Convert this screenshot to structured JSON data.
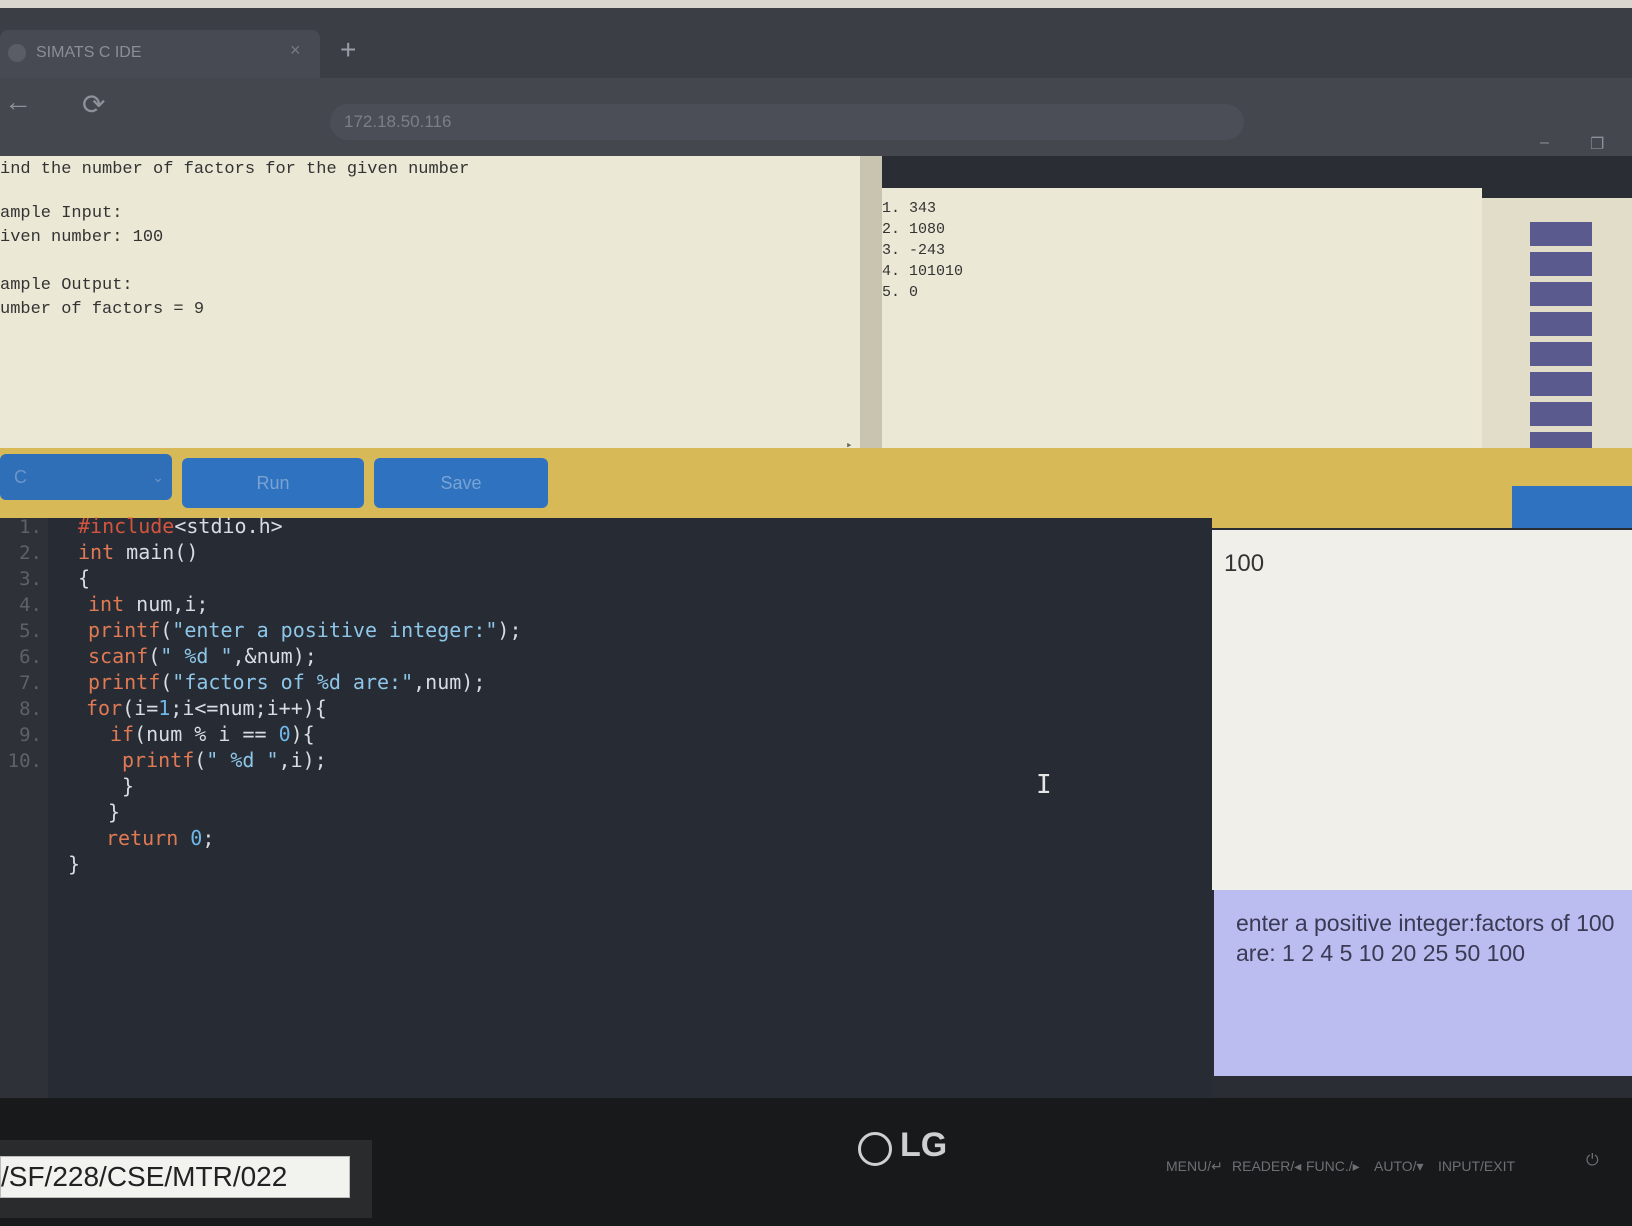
{
  "browser": {
    "tab_title": "SIMATS C IDE",
    "tab_close": "×",
    "new_tab": "+",
    "back": "←",
    "reload": "⟳",
    "url": "172.18.50.116",
    "minimize": "–",
    "restore": "❐"
  },
  "problem": {
    "title": "ind the number of factors for the given number",
    "sample": "ample Input:\niven number: 100\n\nample Output:\number of factors = 9",
    "arrow_down": "▾",
    "arrow_right": "▸",
    "arrow_left": "◂"
  },
  "testcases": [
    "1. 343",
    "2. 1080",
    "3. -243",
    "4. 101010",
    "5. 0"
  ],
  "actions": {
    "language": "C",
    "language_chevron": "⌄",
    "run_label": "Run",
    "save_label": "Save"
  },
  "editor": {
    "line_numbers": [
      "1.",
      "2.",
      "3.",
      "4.",
      "5.",
      "6.",
      "7.",
      "8.",
      "9.",
      "10."
    ],
    "code": {
      "l1_pre": "#include",
      "l1_rest": "<stdio.h>",
      "l2_kw": "int",
      "l2_rest": " main()",
      "l3": "{",
      "l4_kw": "int",
      "l4_rest": " num,i;",
      "l5_fn": "printf",
      "l5_p1": "(",
      "l5_str": "\"enter a positive integer:\"",
      "l5_p2": ");",
      "l6_fn": "scanf",
      "l6_p1": "(",
      "l6_str": "\" %d \"",
      "l6_p2": ",&num);",
      "l7_fn": "printf",
      "l7_p1": "(",
      "l7_str": "\"factors of %d are:\"",
      "l7_p2": ",num);",
      "l8_kw": "for",
      "l8_p1": "(i=",
      "l8_num1": "1",
      "l8_p2": ";i<=num;i++){",
      "l9_kw": "if",
      "l9_p1": "(num % i == ",
      "l9_num": "0",
      "l9_p2": "){",
      "l10_fn": "printf",
      "l10_p1": "(",
      "l10_str": "\" %d \"",
      "l10_p2": ",i);",
      "l11": "}",
      "l12": "}",
      "l13_kw": "return",
      "l13_p1": " ",
      "l13_num": "0",
      "l13_p2": ";",
      "l14": "}"
    },
    "cursor_glyph": "I"
  },
  "io": {
    "input_value": "100",
    "output_text": "enter a positive integer:factors of 100 are: 1  2  4  5  10  20  25  50  100"
  },
  "monitor": {
    "asset_label": "/SF/228/CSE/MTR/022",
    "brand": "LG",
    "buttons": [
      "MENU/↵",
      "READER/◂",
      "FUNC./▸",
      "AUTO/▾",
      "INPUT/EXIT"
    ],
    "power": "⏻"
  }
}
